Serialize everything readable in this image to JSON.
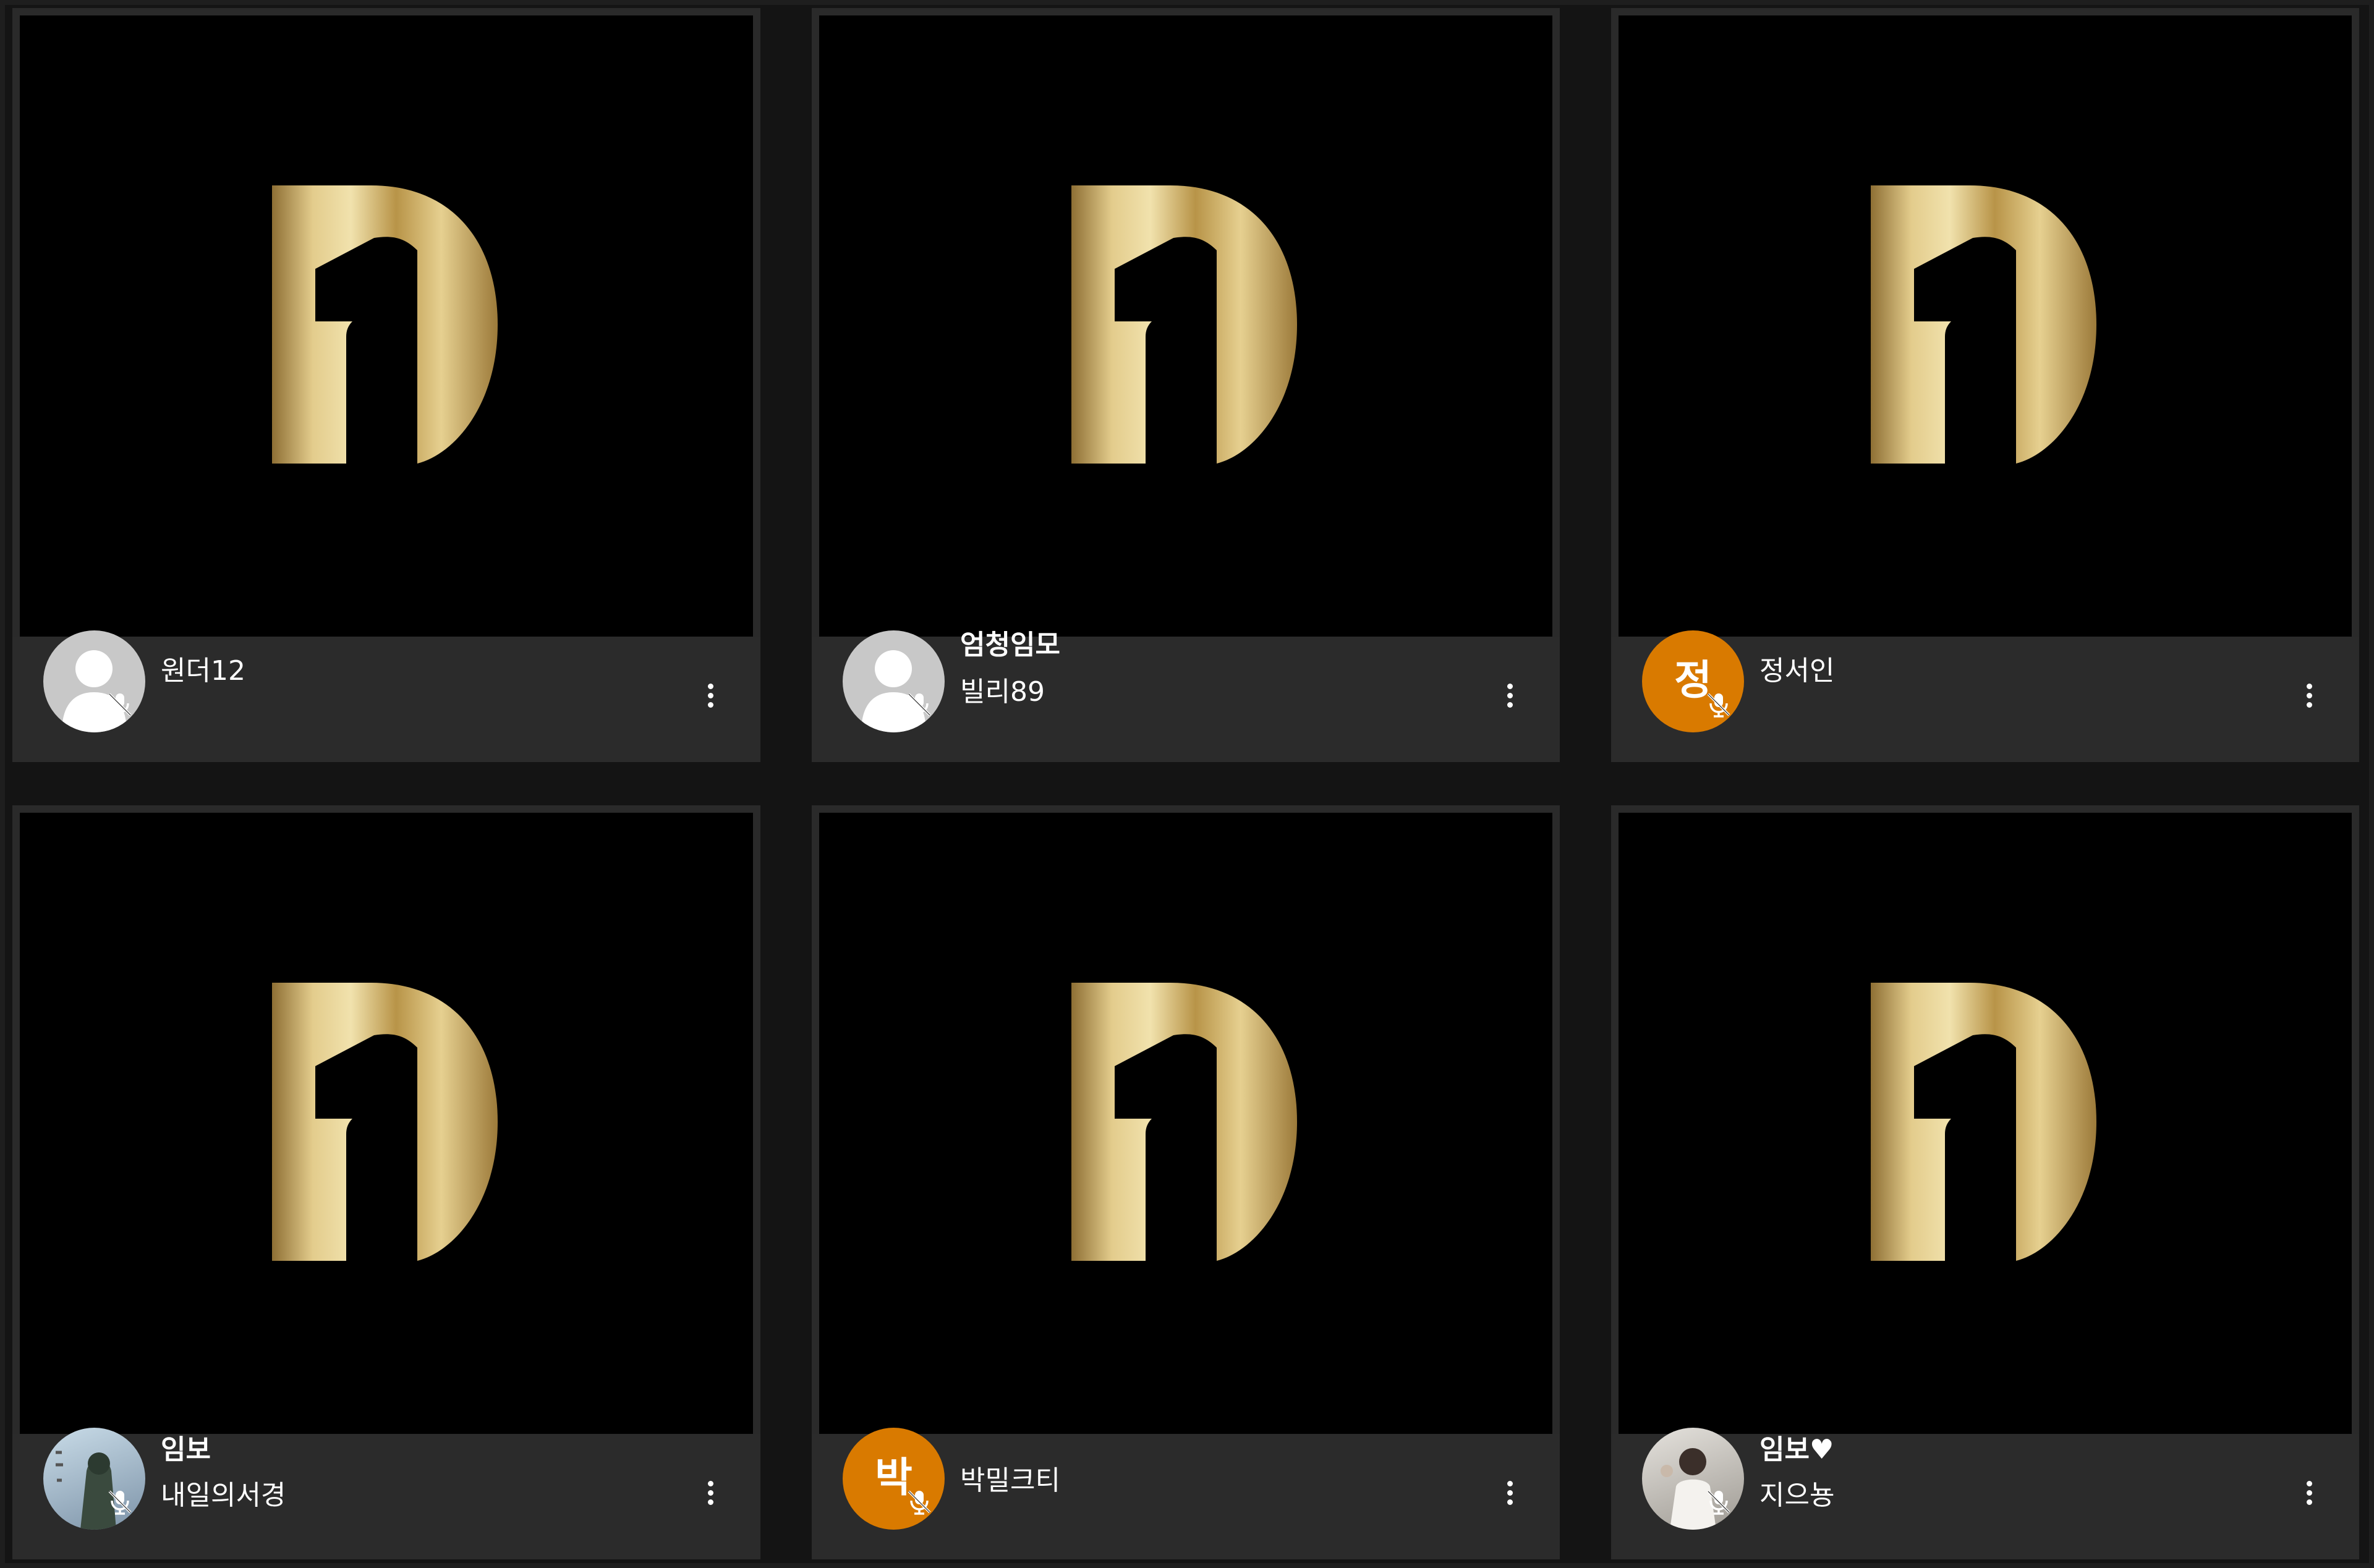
{
  "participants": [
    {
      "initial": "",
      "line1": "",
      "line2": "원더12",
      "mic": "muted"
    },
    {
      "initial": "",
      "line1": "엄청임모",
      "line2": "빌리89",
      "mic": "muted"
    },
    {
      "initial": "정",
      "line1": "",
      "line2": "정서인",
      "mic": "muted"
    },
    {
      "initial": "",
      "line1": "임보",
      "line2": "내일의서경",
      "mic": "muted"
    },
    {
      "initial": "박",
      "line1": "",
      "line2": "박밀크티",
      "mic": "muted"
    },
    {
      "initial": "",
      "line1": "임보♥",
      "line2": "지으뇽",
      "mic": "muted"
    }
  ],
  "colors": {
    "accent_orange": "#d97a00",
    "tile_bg": "#2a2a2a",
    "logo_gold": "#c9a850"
  },
  "icons": {
    "logo": "gold-d-logo-icon",
    "mic": "mic-muted-icon",
    "menu": "more-vertical-icon"
  }
}
